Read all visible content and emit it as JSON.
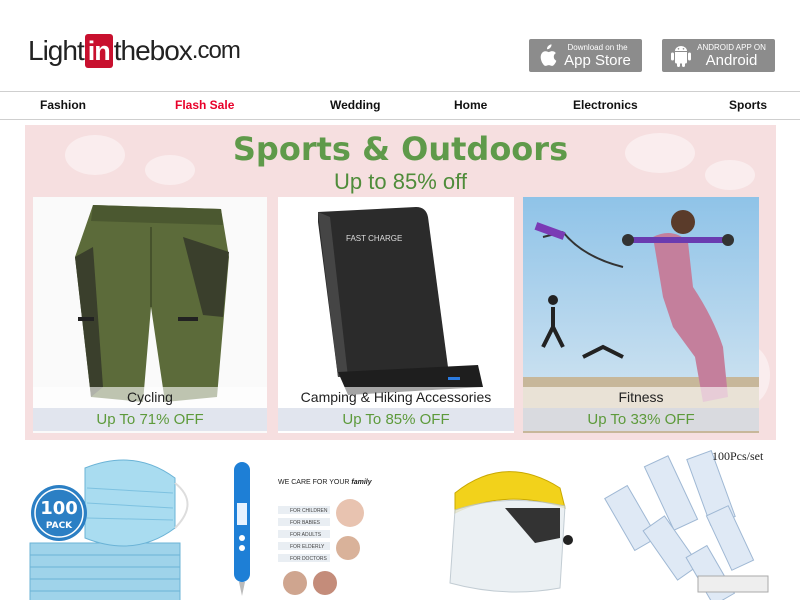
{
  "header": {
    "logo": {
      "part1": "Light",
      "part2": "in",
      "part3": "thebox",
      "part4": ".com"
    },
    "app_store": {
      "sub": "Download on the",
      "main": "App Store"
    },
    "android": {
      "sub": "ANDROID APP ON",
      "main": "Android"
    }
  },
  "nav": {
    "items": [
      "Fashion",
      "Flash Sale",
      "Wedding",
      "Home",
      "Electronics",
      "Sports"
    ]
  },
  "banner": {
    "title": "Sports & Outdoors",
    "subtitle": "Up to 85% off",
    "tiles": [
      {
        "label": "Cycling",
        "offer": "Up To 71% OFF"
      },
      {
        "label": "Camping & Hiking Accessories",
        "offer": "Up To 85% OFF"
      },
      {
        "label": "Fitness",
        "offer": "Up To 33% OFF"
      }
    ]
  },
  "products": {
    "mask_badge": {
      "number": "100",
      "word": "PACK"
    },
    "thermo_card": {
      "heading": "WE CARE FOR YOUR",
      "heading_em": "family",
      "lines": [
        "FOR CHILDREN",
        "FOR BABIES",
        "FOR ADULTS",
        "FOR ELDERLY",
        "FOR DOCTORS"
      ]
    },
    "set_label": "100Pcs/set"
  },
  "product_images": {
    "charger_text": "FAST CHARGE"
  },
  "colors": {
    "brand_red": "#c8102e",
    "flash_sale": "#e8002a",
    "banner_green": "#5f9a4a",
    "banner_bg": "#f6dfe0",
    "store_button": "#8c8c8c"
  }
}
